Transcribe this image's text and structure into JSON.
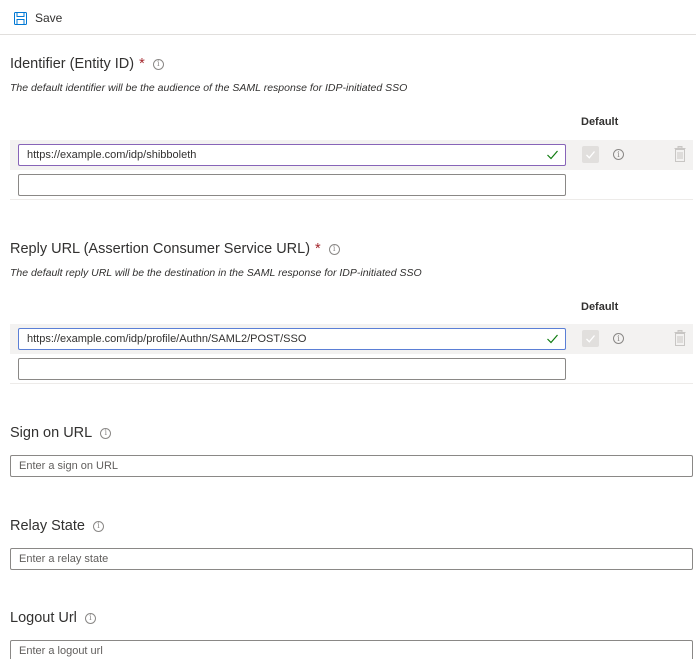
{
  "toolbar": {
    "save_label": "Save",
    "save_icon": "save-icon"
  },
  "identifier": {
    "title": "Identifier (Entity ID)",
    "required": "*",
    "description": "The default identifier will be the audience of the SAML response for IDP-initiated SSO",
    "default_header": "Default",
    "values": [
      "https://example.com/idp/shibboleth",
      ""
    ]
  },
  "reply_url": {
    "title": "Reply URL (Assertion Consumer Service URL)",
    "required": "*",
    "description": "The default reply URL will be the destination in the SAML response for IDP-initiated SSO",
    "default_header": "Default",
    "values": [
      "https://example.com/idp/profile/Authn/SAML2/POST/SSO",
      ""
    ]
  },
  "sign_on_url": {
    "title": "Sign on URL",
    "placeholder": "Enter a sign on URL"
  },
  "relay_state": {
    "title": "Relay State",
    "placeholder": "Enter a relay state"
  },
  "logout_url": {
    "title": "Logout Url",
    "placeholder": "Enter a logout url"
  },
  "colors": {
    "required": "#a4262c",
    "active_border": "#8764b8",
    "check": "#107c10",
    "row_bg": "#f3f2f1",
    "save_icon": "#0078d4"
  }
}
